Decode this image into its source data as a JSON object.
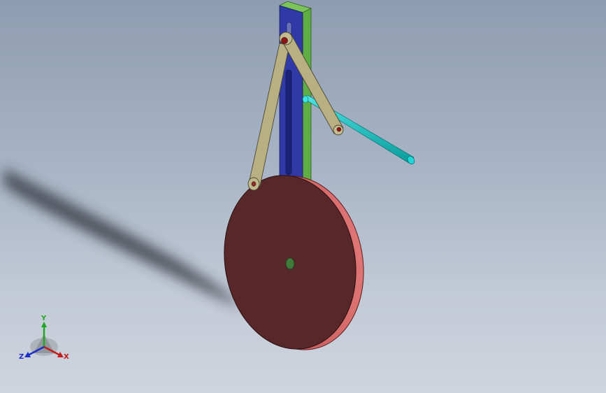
{
  "view": {
    "background_top": "#8e9cb1",
    "background_bottom": "#cfd5de"
  },
  "parts": {
    "frame_front": "#2f3aa8",
    "frame_side": "#5fae45",
    "link": "#b8b083",
    "disc_face": "#57272a",
    "disc_rim": "#cc5f5f",
    "rod": "#13c9c9",
    "hub": "#3f7c3a",
    "pin": "#8c1616"
  },
  "triad": {
    "x_label": "X",
    "y_label": "Y",
    "z_label": "Z",
    "x_color": "#c41a1a",
    "y_color": "#1fa81f",
    "z_color": "#1c2fc8"
  }
}
